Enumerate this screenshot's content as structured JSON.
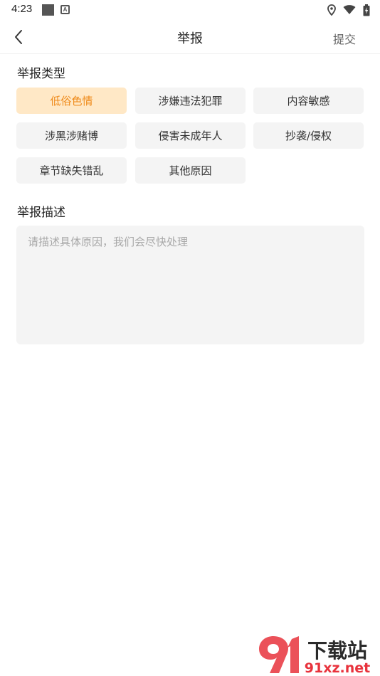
{
  "status_bar": {
    "time": "4:23",
    "notification_icon": "android-a-icon"
  },
  "nav": {
    "title": "举报",
    "submit_label": "提交",
    "back_icon": "chevron-left-icon"
  },
  "report_types": {
    "label": "举报类型",
    "selected_index": 0,
    "items": [
      {
        "label": "低俗色情"
      },
      {
        "label": "涉嫌违法犯罪"
      },
      {
        "label": "内容敏感"
      },
      {
        "label": "涉黑涉赌博"
      },
      {
        "label": "侵害未成年人"
      },
      {
        "label": "抄袭/侵权"
      },
      {
        "label": "章节缺失错乱"
      },
      {
        "label": "其他原因"
      }
    ]
  },
  "description": {
    "label": "举报描述",
    "value": "",
    "placeholder": "请描述具体原因，我们会尽快处理"
  },
  "colors": {
    "accent": "#ef8a1a",
    "accent_bg": "#ffe8c6",
    "chip_bg": "#f4f4f4",
    "watermark_red": "#e8323c"
  },
  "watermark": {
    "brand": "下载站",
    "domain": "91xz.net"
  }
}
